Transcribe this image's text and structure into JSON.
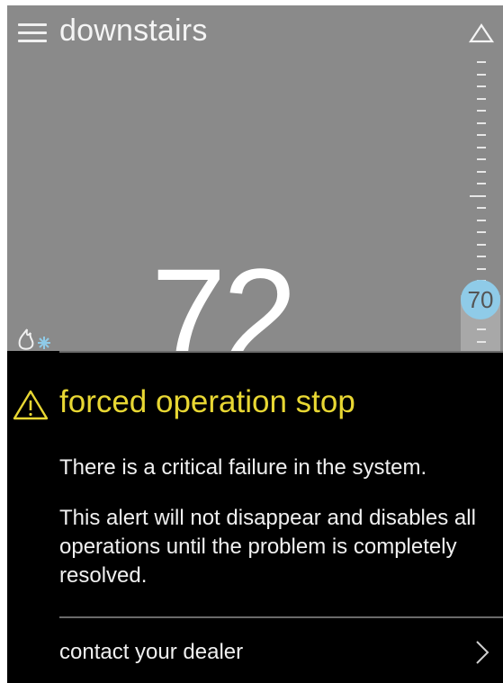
{
  "header": {
    "title": "downstairs"
  },
  "thermostat": {
    "current_temp": "72",
    "setpoint": "70"
  },
  "icons": {
    "menu": "hamburger-menu-icon",
    "up": "up-triangle-icon",
    "mode": "heat-cool-mode-icon",
    "warning": "warning-triangle-icon",
    "chevron": "chevron-right-icon"
  },
  "alert": {
    "title": "forced operation stop",
    "message_1": "There is a critical failure in the system.",
    "message_2": "This alert will not disappear and disables all operations until the problem is completely resolved.",
    "action_label": "contact your dealer"
  },
  "colors": {
    "background": "#8a8a8a",
    "alert_background": "#000000",
    "alert_title": "#e8d733",
    "setpoint_bubble": "#8fcbe8"
  }
}
